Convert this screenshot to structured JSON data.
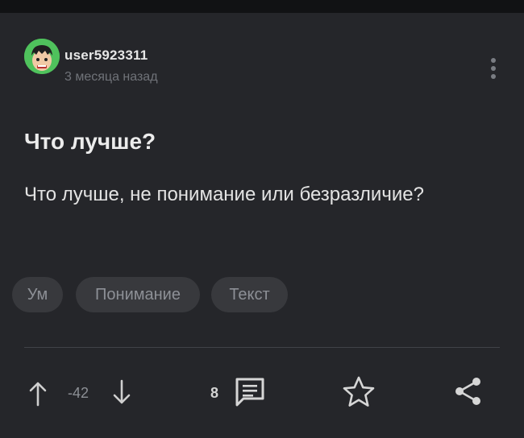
{
  "post": {
    "author": "user5923311",
    "time_ago": "3 месяца назад",
    "title": "Что лучше?",
    "body": "Что лучше, не понимание или безразличие?",
    "tags": [
      "Ум",
      "Понимание",
      "Текст"
    ]
  },
  "actions": {
    "rating": "-42",
    "comments_count": "8"
  },
  "icons": {
    "more": "more-vertical-icon",
    "upvote": "arrow-up-icon",
    "downvote": "arrow-down-icon",
    "comments": "comment-icon",
    "save": "star-icon",
    "share": "share-icon"
  },
  "colors": {
    "background": "#25262a",
    "text": "#e3e3e3",
    "muted": "#707379",
    "tag_bg": "#38393d"
  }
}
